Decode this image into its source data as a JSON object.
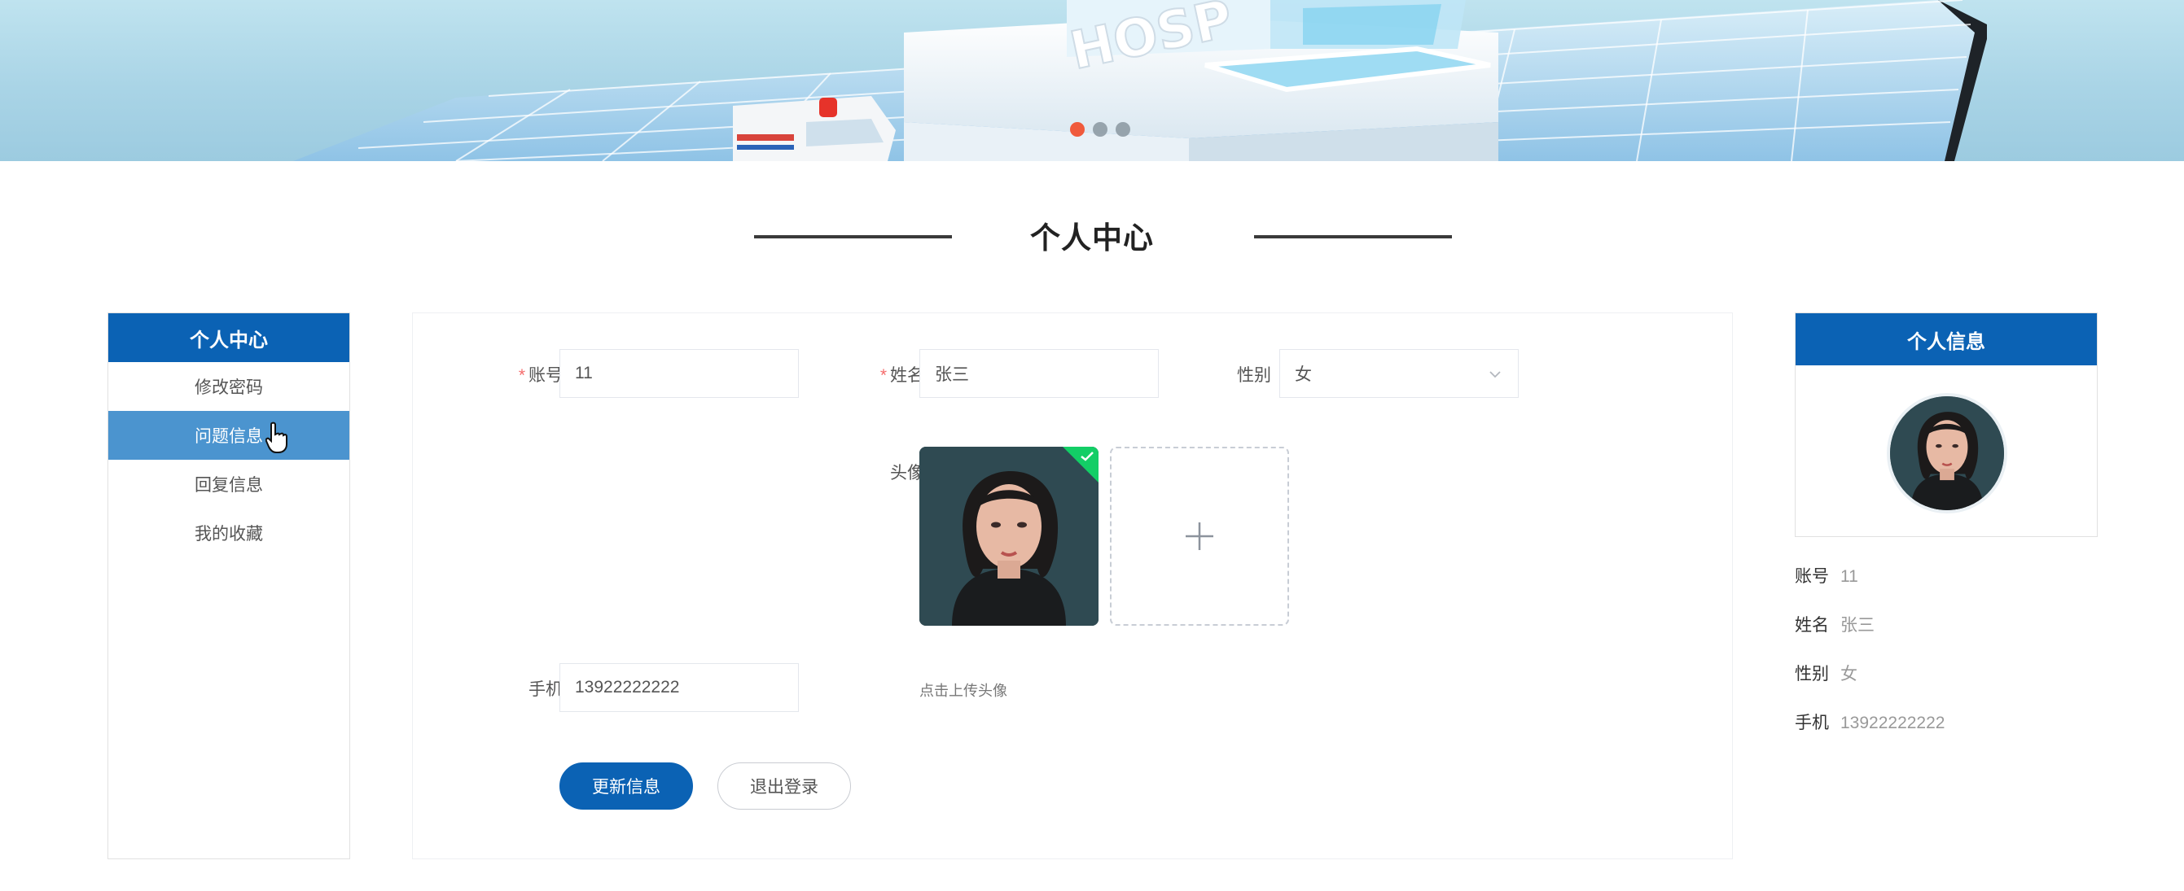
{
  "banner": {
    "slides": [
      "slide-1",
      "slide-2",
      "slide-3"
    ],
    "active_slide": 1,
    "sign_text": "HOSP"
  },
  "page": {
    "title": "个人中心"
  },
  "sidebar": {
    "title": "个人中心",
    "items": [
      {
        "label": "修改密码",
        "active": false
      },
      {
        "label": "问题信息",
        "active": true
      },
      {
        "label": "回复信息",
        "active": false
      },
      {
        "label": "我的收藏",
        "active": false
      }
    ]
  },
  "form": {
    "account": {
      "label": "账号",
      "value": "11",
      "required": true
    },
    "name": {
      "label": "姓名",
      "value": "张三",
      "required": true
    },
    "gender": {
      "label": "性别",
      "value": "女"
    },
    "avatar": {
      "label": "头像",
      "upload_tip": "点击上传头像"
    },
    "phone": {
      "label": "手机",
      "value": "13922222222"
    },
    "update_button": "更新信息",
    "logout_button": "退出登录"
  },
  "profile": {
    "title": "个人信息",
    "rows": [
      {
        "key": "账号",
        "value": "11"
      },
      {
        "key": "姓名",
        "value": "张三"
      },
      {
        "key": "性别",
        "value": "女"
      },
      {
        "key": "手机",
        "value": "13922222222"
      }
    ]
  },
  "colors": {
    "primary": "#0b62b4",
    "menu_active": "#4b94cf",
    "required": "#f56c6c",
    "upload_success": "#13ce66",
    "dot_active": "#f05a3c"
  }
}
